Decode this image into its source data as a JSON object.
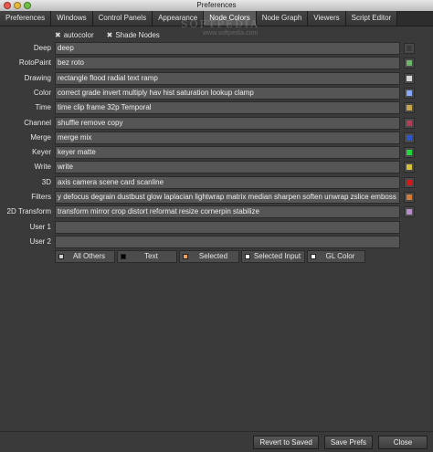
{
  "window": {
    "title": "Preferences"
  },
  "watermark": {
    "text": "SOFTPEDIA",
    "url": "www.softpedia.com"
  },
  "tabs": [
    {
      "label": "Preferences",
      "active": false
    },
    {
      "label": "Windows",
      "active": false
    },
    {
      "label": "Control Panels",
      "active": false
    },
    {
      "label": "Appearance",
      "active": false
    },
    {
      "label": "Node Colors",
      "active": true
    },
    {
      "label": "Node Graph",
      "active": false
    },
    {
      "label": "Viewers",
      "active": false
    },
    {
      "label": "Script Editor",
      "active": false
    }
  ],
  "options": {
    "autocolor": {
      "label": "autocolor",
      "checked": true
    },
    "shade_nodes": {
      "label": "Shade Nodes",
      "checked": true
    }
  },
  "rows": [
    {
      "label": "Deep",
      "value": "deep",
      "color": "#3a3a3a"
    },
    {
      "label": "RotoPaint",
      "value": "bez roto",
      "color": "#6eb46a"
    },
    {
      "label": "Drawing",
      "value": "rectangle flood radial text ramp",
      "color": "#d7d7d7"
    },
    {
      "label": "Color",
      "value": "correct grade invert multiply hav hist saturation lookup clamp",
      "color": "#8aa8ff"
    },
    {
      "label": "Time",
      "value": "time clip frame 32p Temporal",
      "color": "#c9a64b"
    },
    {
      "label": "Channel",
      "value": "shuffle remove copy",
      "color": "#b0405a"
    },
    {
      "label": "Merge",
      "value": "merge mix",
      "color": "#2f55c9"
    },
    {
      "label": "Keyer",
      "value": "keyer matte",
      "color": "#22d63c"
    },
    {
      "label": "Write",
      "value": "write",
      "color": "#d6c23a"
    },
    {
      "label": "3D",
      "value": "axis camera scene card scanline",
      "color": "#d11b1b"
    },
    {
      "label": "Filters",
      "value": "y defocus degrain dustbust glow laplacian lightwrap matrix median sharpen soften unwrap zslice emboss",
      "color": "#d37b3a"
    },
    {
      "label": "2D Transform",
      "value": "transform mirror crop distort reformat resize cornerpin stabilize",
      "color": "#b58cc4"
    },
    {
      "label": "User 1",
      "value": "",
      "color": ""
    },
    {
      "label": "User 2",
      "value": "",
      "color": ""
    }
  ],
  "color_buttons": [
    {
      "label": "All Others",
      "color": "#d0d0d0"
    },
    {
      "label": "Text",
      "color": "#000000"
    },
    {
      "label": "Selected",
      "color": "#f0a050"
    },
    {
      "label": "Selected Input",
      "color": "#ffffff"
    },
    {
      "label": "GL Color",
      "color": "#ffffff"
    }
  ],
  "footer": {
    "revert_label": "Revert to Saved",
    "save_label": "Save Prefs",
    "close_label": "Close"
  }
}
